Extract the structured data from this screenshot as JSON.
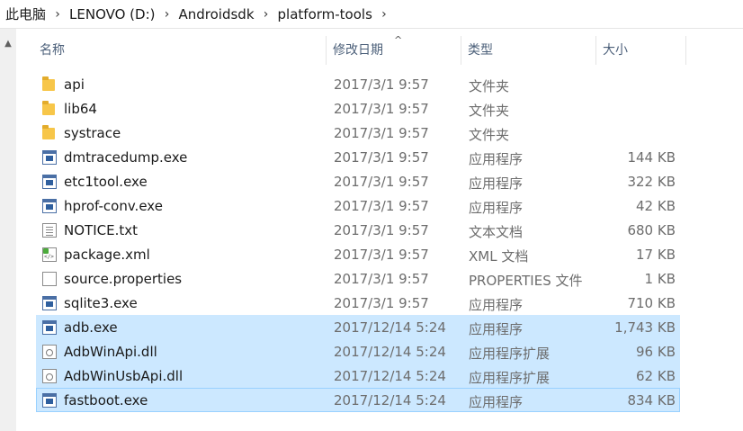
{
  "breadcrumb": [
    "此电脑",
    "LENOVO (D:)",
    "Androidsdk",
    "platform-tools"
  ],
  "breadcrumb_separator": "›",
  "columns": {
    "name": "名称",
    "date": "修改日期",
    "type": "类型",
    "size": "大小"
  },
  "files": [
    {
      "name": "api",
      "date": "2017/3/1 9:57",
      "type": "文件夹",
      "size": "",
      "icon": "folder-icon"
    },
    {
      "name": "lib64",
      "date": "2017/3/1 9:57",
      "type": "文件夹",
      "size": "",
      "icon": "folder-icon"
    },
    {
      "name": "systrace",
      "date": "2017/3/1 9:57",
      "type": "文件夹",
      "size": "",
      "icon": "folder-icon"
    },
    {
      "name": "dmtracedump.exe",
      "date": "2017/3/1 9:57",
      "type": "应用程序",
      "size": "144 KB",
      "icon": "exe-icon"
    },
    {
      "name": "etc1tool.exe",
      "date": "2017/3/1 9:57",
      "type": "应用程序",
      "size": "322 KB",
      "icon": "exe-icon"
    },
    {
      "name": "hprof-conv.exe",
      "date": "2017/3/1 9:57",
      "type": "应用程序",
      "size": "42 KB",
      "icon": "exe-icon"
    },
    {
      "name": "NOTICE.txt",
      "date": "2017/3/1 9:57",
      "type": "文本文档",
      "size": "680 KB",
      "icon": "text-file-icon"
    },
    {
      "name": "package.xml",
      "date": "2017/3/1 9:57",
      "type": "XML 文档",
      "size": "17 KB",
      "icon": "xml-file-icon"
    },
    {
      "name": "source.properties",
      "date": "2017/3/1 9:57",
      "type": "PROPERTIES 文件",
      "size": "1 KB",
      "icon": "generic-file-icon"
    },
    {
      "name": "sqlite3.exe",
      "date": "2017/3/1 9:57",
      "type": "应用程序",
      "size": "710 KB",
      "icon": "exe-icon"
    },
    {
      "name": "adb.exe",
      "date": "2017/12/14 5:24",
      "type": "应用程序",
      "size": "1,743 KB",
      "icon": "exe-icon",
      "selected": true
    },
    {
      "name": "AdbWinApi.dll",
      "date": "2017/12/14 5:24",
      "type": "应用程序扩展",
      "size": "96 KB",
      "icon": "dll-icon",
      "selected": true
    },
    {
      "name": "AdbWinUsbApi.dll",
      "date": "2017/12/14 5:24",
      "type": "应用程序扩展",
      "size": "62 KB",
      "icon": "dll-icon",
      "selected": true
    },
    {
      "name": "fastboot.exe",
      "date": "2017/12/14 5:24",
      "type": "应用程序",
      "size": "834 KB",
      "icon": "exe-icon",
      "selected": true,
      "focused": true
    }
  ],
  "colors": {
    "selection": "#cce8ff",
    "focus_border": "#99d1ff",
    "header_text": "#4c607a",
    "folder": "#f7c649"
  }
}
